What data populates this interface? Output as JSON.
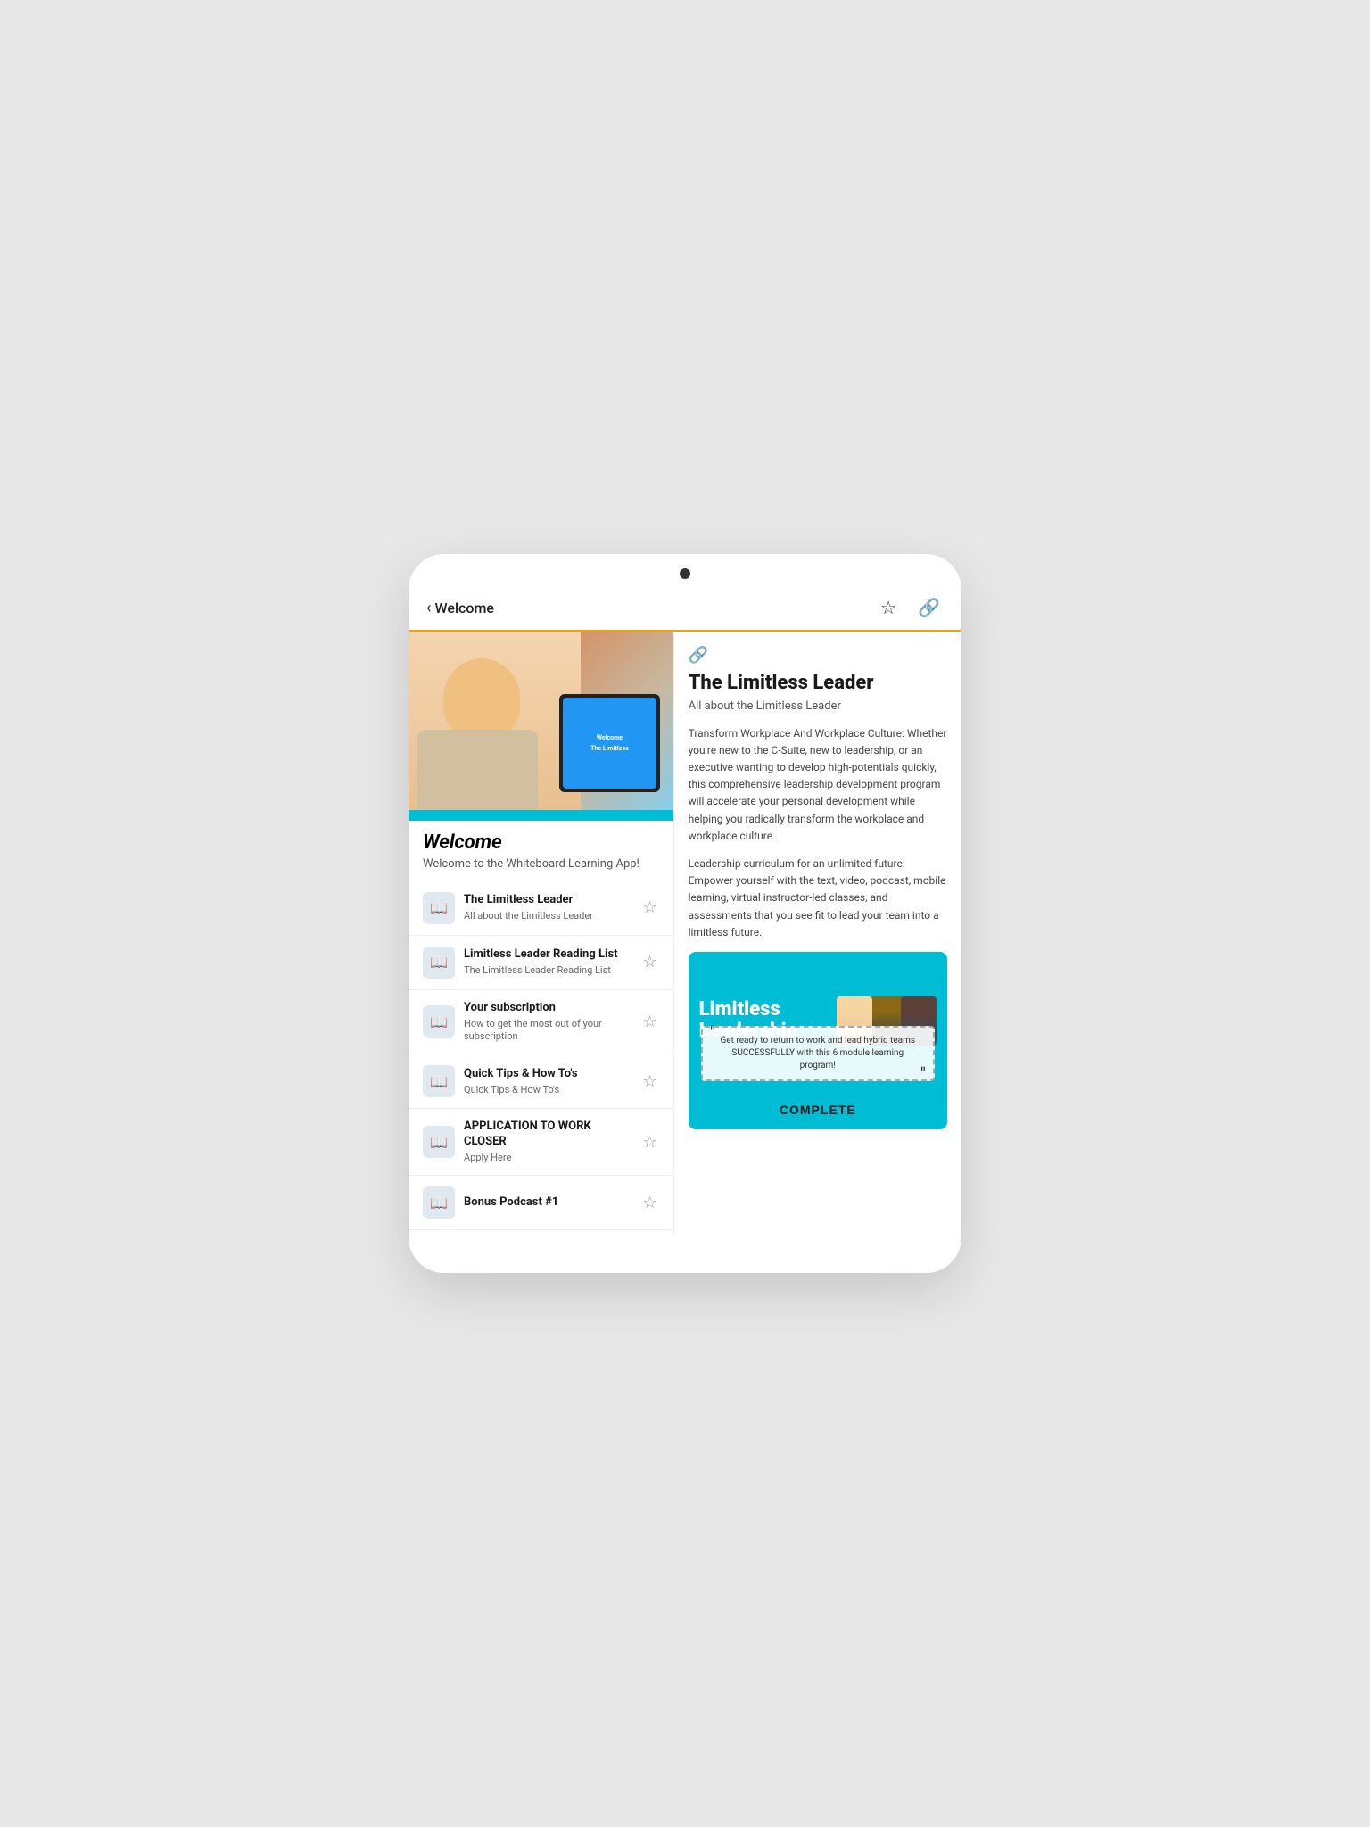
{
  "device": {
    "notch_label": "notch"
  },
  "nav": {
    "back_label": "Welcome",
    "star_icon": "☆",
    "link_icon": "🔗"
  },
  "left": {
    "welcome_title": "Welcome",
    "welcome_subtitle": "Welcome to the Whiteboard Learning App!",
    "list_items": [
      {
        "id": "limitless-leader",
        "title": "The Limitless Leader",
        "subtitle": "All about the Limitless Leader"
      },
      {
        "id": "reading-list",
        "title": "Limitless Leader Reading List",
        "subtitle": "The Limitless Leader Reading List"
      },
      {
        "id": "subscription",
        "title": "Your subscription",
        "subtitle": "How to get the most out of your subscription"
      },
      {
        "id": "quick-tips",
        "title": "Quick Tips & How To's",
        "subtitle": "Quick Tips & How To's"
      },
      {
        "id": "application",
        "title": "APPLICATION TO WORK CLOSER",
        "subtitle": "Apply Here"
      },
      {
        "id": "bonus-podcast",
        "title": "Bonus Podcast #1",
        "subtitle": ""
      }
    ]
  },
  "right": {
    "link_icon": "🔗",
    "course_title": "The Limitless Leader",
    "course_subtitle": "All about the Limitless Leader",
    "desc1": "Transform Workplace And Workplace Culture: Whether you're new to the C-Suite, new to leadership, or an executive wanting to develop high-potentials quickly, this comprehensive leadership development program will accelerate your personal development while helping you radically transform the workplace and workplace culture.",
    "desc2": "Leadership curriculum for an unlimited future: Empower yourself with the text, video, podcast, mobile learning, virtual instructor-led classes, and assessments that you see fit to lead your team into a limitless future.",
    "banner_title": "Limitless Leadership",
    "quote_text": "Get ready to return to work and lead hybrid teams SUCCESSFULLY with this 6 module learning program!",
    "complete_label": "COMPLETE"
  }
}
